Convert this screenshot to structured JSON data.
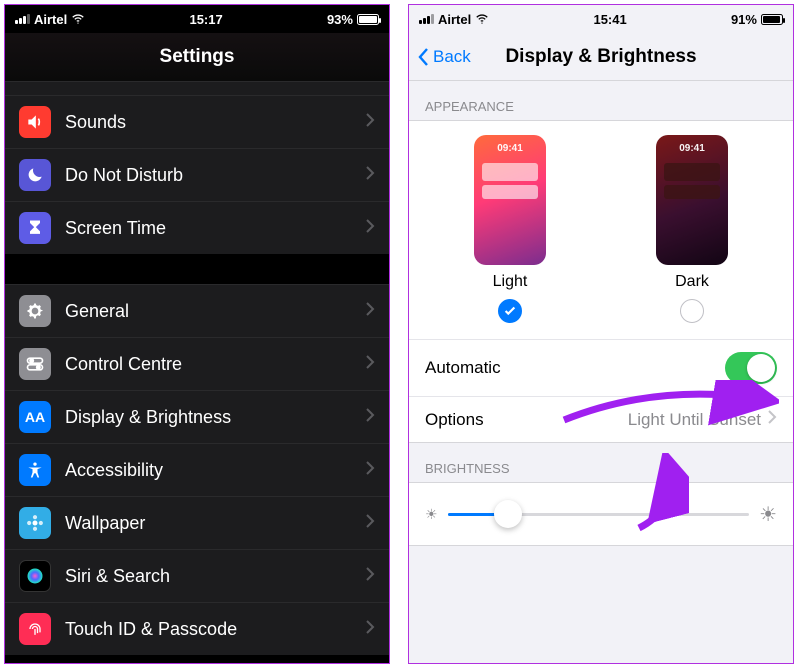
{
  "left": {
    "status": {
      "carrier": "Airtel",
      "time": "15:17",
      "battery_text": "93%"
    },
    "title": "Settings",
    "rows": [
      {
        "label": "Sounds"
      },
      {
        "label": "Do Not Disturb"
      },
      {
        "label": "Screen Time"
      },
      {
        "label": "General"
      },
      {
        "label": "Control Centre"
      },
      {
        "label": "Display & Brightness"
      },
      {
        "label": "Accessibility"
      },
      {
        "label": "Wallpaper"
      },
      {
        "label": "Siri & Search"
      },
      {
        "label": "Touch ID & Passcode"
      }
    ]
  },
  "right": {
    "status": {
      "carrier": "Airtel",
      "time": "15:41",
      "battery_text": "91%"
    },
    "back": "Back",
    "title": "Display & Brightness",
    "appearance_header": "APPEARANCE",
    "appearance": {
      "light_label": "Light",
      "dark_label": "Dark",
      "thumb_time": "09:41",
      "selected": "light"
    },
    "automatic_label": "Automatic",
    "automatic_on": true,
    "options_label": "Options",
    "options_value": "Light Until Sunset",
    "brightness_header": "BRIGHTNESS",
    "brightness_value": 0.2
  }
}
